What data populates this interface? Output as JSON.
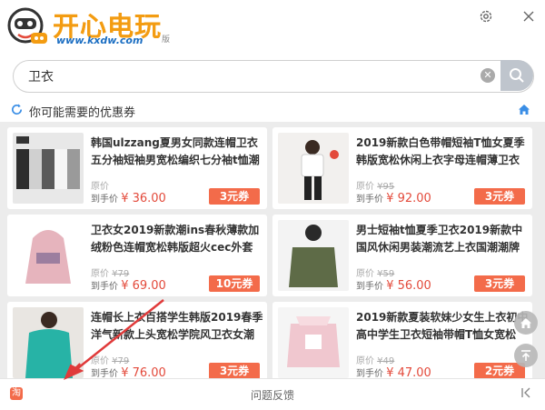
{
  "app": {
    "logo_text": "开心电玩",
    "logo_url": "www.kxdw.com",
    "logo_suffix": "版"
  },
  "window_controls": [
    "settings-icon",
    "close-icon"
  ],
  "search": {
    "value": "卫衣",
    "clear_icon": "clear-icon",
    "search_icon": "search-icon"
  },
  "section": {
    "title": "你可能需要的优惠券",
    "refresh_icon": "refresh-icon",
    "home_icon": "home-icon"
  },
  "products": [
    {
      "title": "韩国ulzzang夏男女同款连帽卫衣五分袖短袖男宽松编织七分袖t恤潮",
      "orig_label": "原价",
      "orig_price": "",
      "price_label": "到手价",
      "price": "¥ 36.00",
      "coupon": "3元券"
    },
    {
      "title": "2019新款白色带帽短袖T恤女夏季韩版宽松休闲上衣字母连帽薄卫衣",
      "orig_label": "原价",
      "orig_price": "¥95",
      "price_label": "到手价",
      "price": "¥ 92.00",
      "coupon": "3元券"
    },
    {
      "title": "卫衣女2019新款潮ins春秋薄款加绒粉色连帽宽松韩版超火cec外套头",
      "orig_label": "原价",
      "orig_price": "¥79",
      "price_label": "到手价",
      "price": "¥ 69.00",
      "coupon": "10元券"
    },
    {
      "title": "男士短袖t恤夏季卫衣2019新款中国风休闲男装潮流艺上衣国潮潮牌",
      "orig_label": "原价",
      "orig_price": "¥59",
      "price_label": "到手价",
      "price": "¥ 56.00",
      "coupon": "3元券"
    },
    {
      "title": "连帽长上衣百搭学生韩版2019春季洋气新款上头宽松学院风卫衣女潮",
      "orig_label": "原价",
      "orig_price": "¥79",
      "price_label": "到手价",
      "price": "¥ 76.00",
      "coupon": "3元券"
    },
    {
      "title": "2019新款夏装软妹少女生上衣初中高中学生卫衣短袖带帽T恤女宽松",
      "orig_label": "原价",
      "orig_price": "¥49",
      "price_label": "到手价",
      "price": "¥ 47.00",
      "coupon": "2元券"
    }
  ],
  "floating": [
    "home-float-icon",
    "back-to-top-icon"
  ],
  "footer": {
    "feedback": "问题反馈",
    "taobao_icon": "taobao-icon",
    "collapse_icon": "collapse-icon"
  },
  "colors": {
    "accent": "#f36b4a",
    "price": "#e34a3b",
    "brand": "#f39c12",
    "link_blue": "#1b6ec2"
  }
}
